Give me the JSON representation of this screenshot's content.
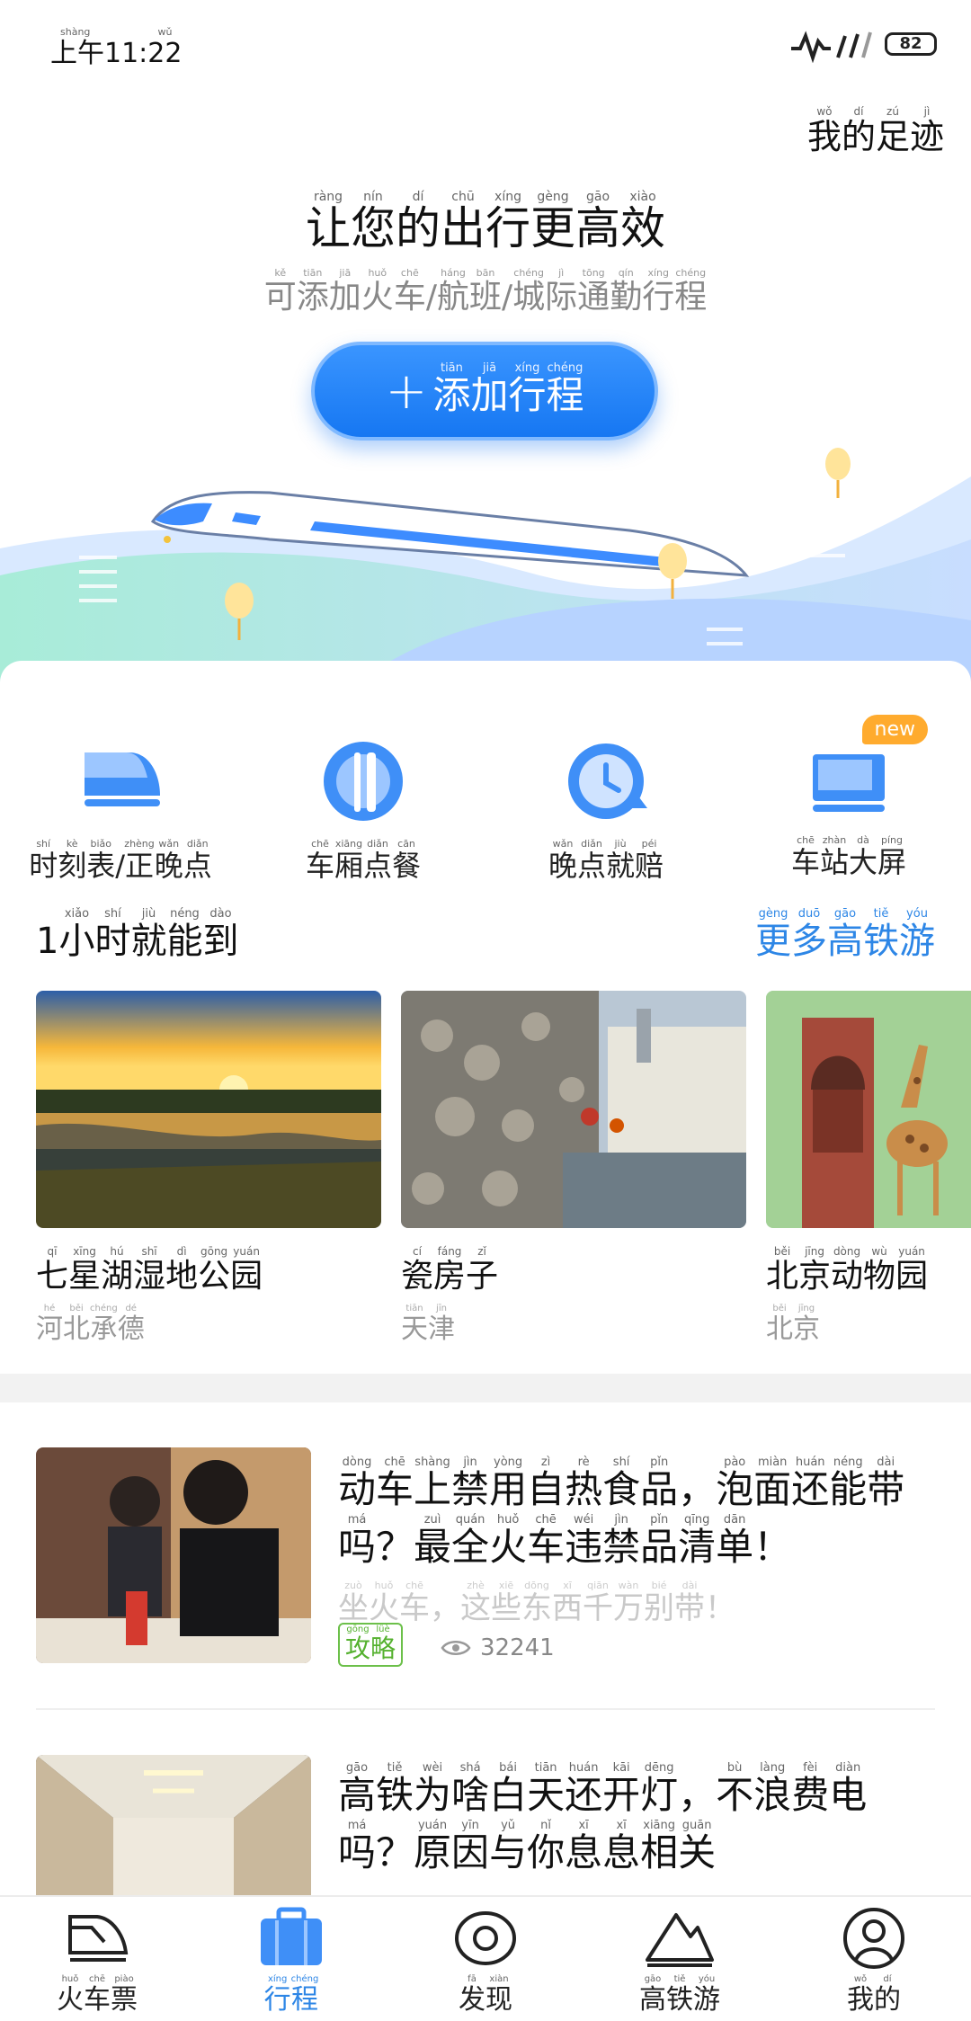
{
  "status_bar": {
    "time_pinyin": "shàng wǔ",
    "time": "上午11:22",
    "battery": "82"
  },
  "header": {
    "footprint": {
      "chars": [
        [
          "我",
          "wǒ"
        ],
        [
          "的",
          "dí"
        ],
        [
          "足",
          "zú"
        ],
        [
          "迹",
          "jì"
        ]
      ]
    },
    "title": {
      "chars": [
        [
          "让",
          "ràng"
        ],
        [
          "您",
          "nín"
        ],
        [
          "的",
          "dí"
        ],
        [
          "出",
          "chū"
        ],
        [
          "行",
          "xíng"
        ],
        [
          "更",
          "gèng"
        ],
        [
          "高",
          "gāo"
        ],
        [
          "效",
          "xiào"
        ]
      ]
    },
    "subtitle": {
      "chars": [
        [
          "可",
          "kě"
        ],
        [
          "添",
          "tiān"
        ],
        [
          "加",
          "jiā"
        ],
        [
          "火",
          "huǒ"
        ],
        [
          "车",
          "chē"
        ],
        [
          "/",
          ""
        ],
        [
          "航",
          "háng"
        ],
        [
          "班",
          "bān"
        ],
        [
          "/",
          ""
        ],
        [
          "城",
          "chéng"
        ],
        [
          "际",
          "jì"
        ],
        [
          "通",
          "tōng"
        ],
        [
          "勤",
          "qín"
        ],
        [
          "行",
          "xíng"
        ],
        [
          "程",
          "chéng"
        ]
      ]
    },
    "add_button": {
      "plus": "+",
      "chars": [
        [
          "添",
          "tiān"
        ],
        [
          "加",
          "jiā"
        ],
        [
          "行",
          "xíng"
        ],
        [
          "程",
          "chéng"
        ]
      ]
    }
  },
  "features": [
    {
      "icon": "train-timetable-icon",
      "chars": [
        [
          "时",
          "shí"
        ],
        [
          "刻",
          "kè"
        ],
        [
          "表",
          "biǎo"
        ],
        [
          "/",
          ""
        ],
        [
          "正",
          "zhèng"
        ],
        [
          "晚",
          "wǎn"
        ],
        [
          "点",
          "diǎn"
        ]
      ]
    },
    {
      "icon": "dining-icon",
      "chars": [
        [
          "车",
          "chē"
        ],
        [
          "厢",
          "xiāng"
        ],
        [
          "点",
          "diǎn"
        ],
        [
          "餐",
          "cān"
        ]
      ]
    },
    {
      "icon": "delay-clock-icon",
      "chars": [
        [
          "晚",
          "wǎn"
        ],
        [
          "点",
          "diǎn"
        ],
        [
          "就",
          "jiù"
        ],
        [
          "赔",
          "péi"
        ]
      ]
    },
    {
      "icon": "station-screen-icon",
      "chars": [
        [
          "车",
          "chē"
        ],
        [
          "站",
          "zhàn"
        ],
        [
          "大",
          "dà"
        ],
        [
          "屏",
          "píng"
        ]
      ],
      "badge": "new"
    }
  ],
  "destinations_section": {
    "title": {
      "chars": [
        [
          "1",
          ""
        ],
        [
          "小",
          "xiǎo"
        ],
        [
          "时",
          "shí"
        ],
        [
          "就",
          "jiù"
        ],
        [
          "能",
          "néng"
        ],
        [
          "到",
          "dào"
        ]
      ]
    },
    "more": {
      "chars": [
        [
          "更",
          "gèng"
        ],
        [
          "多",
          "duō"
        ],
        [
          "高",
          "gāo"
        ],
        [
          "铁",
          "tiě"
        ],
        [
          "游",
          "yóu"
        ]
      ]
    },
    "items": [
      {
        "name": [
          [
            "七",
            "qī"
          ],
          [
            "星",
            "xīng"
          ],
          [
            "湖",
            "hú"
          ],
          [
            "湿",
            "shī"
          ],
          [
            "地",
            "dì"
          ],
          [
            "公",
            "gōng"
          ],
          [
            "园",
            "yuán"
          ]
        ],
        "city": [
          [
            "河",
            "hé"
          ],
          [
            "北",
            "běi"
          ],
          [
            "承",
            "chéng"
          ],
          [
            "德",
            "dé"
          ]
        ]
      },
      {
        "name": [
          [
            "瓷",
            "cí"
          ],
          [
            "房",
            "fáng"
          ],
          [
            "子",
            "zǐ"
          ]
        ],
        "city": [
          [
            "天",
            "tiān"
          ],
          [
            "津",
            "jīn"
          ]
        ]
      },
      {
        "name": [
          [
            "北",
            "běi"
          ],
          [
            "京",
            "jīng"
          ],
          [
            "动",
            "dòng"
          ],
          [
            "物",
            "wù"
          ],
          [
            "园",
            "yuán"
          ]
        ],
        "city": [
          [
            "北",
            "běi"
          ],
          [
            "京",
            "jīng"
          ]
        ]
      }
    ]
  },
  "articles": [
    {
      "title": [
        [
          "动",
          "dòng"
        ],
        [
          "车",
          "chē"
        ],
        [
          "上",
          "shàng"
        ],
        [
          "禁",
          "jìn"
        ],
        [
          "用",
          "yòng"
        ],
        [
          "自",
          "zì"
        ],
        [
          "热",
          "rè"
        ],
        [
          "食",
          "shí"
        ],
        [
          "品",
          "pǐn"
        ],
        [
          "，",
          ""
        ],
        [
          "泡",
          "pào"
        ],
        [
          "面",
          "miàn"
        ],
        [
          "还",
          "huán"
        ],
        [
          "能",
          "néng"
        ],
        [
          "带",
          "dài"
        ],
        [
          "吗",
          "má"
        ],
        [
          "？",
          ""
        ],
        [
          "最",
          "zuì"
        ],
        [
          "全",
          "quán"
        ],
        [
          "火",
          "huǒ"
        ],
        [
          "车",
          "chē"
        ],
        [
          "违",
          "wéi"
        ],
        [
          "禁",
          "jìn"
        ],
        [
          "品",
          "pǐn"
        ],
        [
          "清",
          "qīng"
        ],
        [
          "单",
          "dān"
        ],
        [
          "！",
          ""
        ]
      ],
      "subtitle": [
        [
          "坐",
          "zuò"
        ],
        [
          "火",
          "huǒ"
        ],
        [
          "车",
          "chē"
        ],
        [
          "，",
          ""
        ],
        [
          "这",
          "zhè"
        ],
        [
          "些",
          "xiē"
        ],
        [
          "东",
          "dōng"
        ],
        [
          "西",
          "xī"
        ],
        [
          "千",
          "qiān"
        ],
        [
          "万",
          "wàn"
        ],
        [
          "别",
          "bié"
        ],
        [
          "带",
          "dài"
        ],
        [
          "！",
          ""
        ]
      ],
      "tag": {
        "chars": [
          [
            "攻",
            "gōng"
          ],
          [
            "略",
            "lüè"
          ]
        ]
      },
      "views": "32241"
    },
    {
      "title": [
        [
          "高",
          "gāo"
        ],
        [
          "铁",
          "tiě"
        ],
        [
          "为",
          "wèi"
        ],
        [
          "啥",
          "shá"
        ],
        [
          "白",
          "bái"
        ],
        [
          "天",
          "tiān"
        ],
        [
          "还",
          "huán"
        ],
        [
          "开",
          "kāi"
        ],
        [
          "灯",
          "dēng"
        ],
        [
          "，",
          ""
        ],
        [
          "不",
          "bù"
        ],
        [
          "浪",
          "làng"
        ],
        [
          "费",
          "fèi"
        ],
        [
          "电",
          "diàn"
        ],
        [
          "吗",
          "má"
        ],
        [
          "？",
          ""
        ],
        [
          "原",
          "yuán"
        ],
        [
          "因",
          "yīn"
        ],
        [
          "与",
          "yǔ"
        ],
        [
          "你",
          "nǐ"
        ],
        [
          "息",
          "xī"
        ],
        [
          "息",
          "xī"
        ],
        [
          "相",
          "xiāng"
        ],
        [
          "关",
          "guān"
        ]
      ]
    }
  ],
  "bottom_nav": [
    {
      "icon": "train-ticket-icon",
      "chars": [
        [
          "火",
          "huǒ"
        ],
        [
          "车",
          "chē"
        ],
        [
          "票",
          "piào"
        ]
      ],
      "active": false
    },
    {
      "icon": "trip-suitcase-icon",
      "chars": [
        [
          "行",
          "xíng"
        ],
        [
          "程",
          "chéng"
        ]
      ],
      "active": true
    },
    {
      "icon": "discover-icon",
      "chars": [
        [
          "发",
          "fā"
        ],
        [
          "现",
          "xiàn"
        ]
      ],
      "active": false
    },
    {
      "icon": "mountain-icon",
      "chars": [
        [
          "高",
          "gāo"
        ],
        [
          "铁",
          "tiě"
        ],
        [
          "游",
          "yóu"
        ]
      ],
      "active": false
    },
    {
      "icon": "profile-icon",
      "chars": [
        [
          "我",
          "wǒ"
        ],
        [
          "的",
          "dí"
        ]
      ],
      "active": false
    }
  ],
  "colors": {
    "accent": "#2d86e6",
    "button": "#1677f2",
    "tag_green": "#55b12f",
    "badge_orange": "#ffab2e"
  }
}
